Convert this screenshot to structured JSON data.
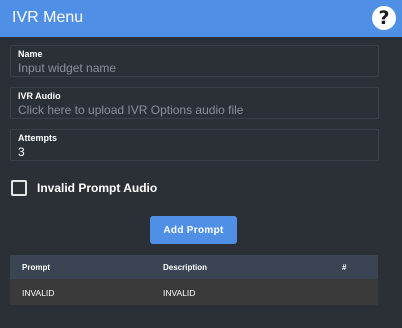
{
  "header": {
    "title": "IVR Menu",
    "help_icon": "question-mark-icon",
    "help_symbol": "?"
  },
  "form": {
    "name": {
      "label": "Name",
      "placeholder": "Input widget name"
    },
    "ivr_audio": {
      "label": "IVR Audio",
      "placeholder": "Click here to upload IVR Options audio file"
    },
    "attempts": {
      "label": "Attempts",
      "value": "3"
    },
    "invalid_prompt_audio": {
      "label": "Invalid Prompt Audio",
      "checked": false
    }
  },
  "add_prompt_button": "Add Prompt",
  "table": {
    "headers": [
      "Prompt",
      "Description",
      "#"
    ],
    "rows": [
      {
        "prompt": "INVALID",
        "description": "INVALID",
        "number": ""
      }
    ]
  },
  "colors": {
    "accent": "#4f8fe6",
    "background": "#2b2f36",
    "table_header": "#3a4452",
    "table_row": "#3a3a3a"
  }
}
